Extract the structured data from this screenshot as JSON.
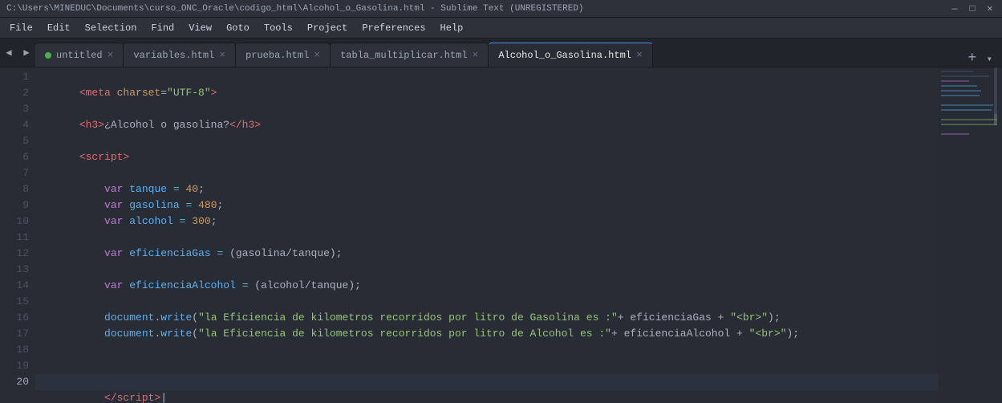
{
  "titlebar": {
    "path": "C:\\Users\\MINEDUC\\Documents\\curso_ONC_Oracle\\codigo_html\\Alcohol_o_Gasolina.html - Sublime Text (UNREGISTERED)",
    "controls": [
      "—",
      "□",
      "✕"
    ]
  },
  "menubar": {
    "items": [
      "File",
      "Edit",
      "Selection",
      "Find",
      "View",
      "Goto",
      "Tools",
      "Project",
      "Preferences",
      "Help"
    ]
  },
  "tabs": [
    {
      "id": "untitled",
      "label": "untitled",
      "active": false,
      "dot": true,
      "close": true
    },
    {
      "id": "variables",
      "label": "variables.html",
      "active": false,
      "dot": false,
      "close": true
    },
    {
      "id": "prueba",
      "label": "prueba.html",
      "active": false,
      "dot": false,
      "close": true
    },
    {
      "id": "tabla_multiplicar",
      "label": "tabla_multiplicar.html",
      "active": false,
      "dot": false,
      "close": true
    },
    {
      "id": "alcohol",
      "label": "Alcohol_o_Gasolina.html",
      "active": true,
      "dot": false,
      "close": true
    }
  ],
  "lines": [
    {
      "num": 1,
      "content": "meta_charset_line",
      "current": false
    },
    {
      "num": 2,
      "content": "empty",
      "current": false
    },
    {
      "num": 3,
      "content": "h3_line",
      "current": false
    },
    {
      "num": 4,
      "content": "empty",
      "current": false
    },
    {
      "num": 5,
      "content": "script_open",
      "current": false
    },
    {
      "num": 6,
      "content": "empty",
      "current": false
    },
    {
      "num": 7,
      "content": "var_tanque",
      "current": false
    },
    {
      "num": 8,
      "content": "var_gasolina",
      "current": false
    },
    {
      "num": 9,
      "content": "var_alcohol",
      "current": false
    },
    {
      "num": 10,
      "content": "empty",
      "current": false
    },
    {
      "num": 11,
      "content": "var_eficienciaGas",
      "current": false
    },
    {
      "num": 12,
      "content": "empty",
      "current": false
    },
    {
      "num": 13,
      "content": "var_eficienciaAlcohol",
      "current": false
    },
    {
      "num": 14,
      "content": "empty",
      "current": false
    },
    {
      "num": 15,
      "content": "doc_write_gas",
      "current": false
    },
    {
      "num": 16,
      "content": "doc_write_alcohol",
      "current": false
    },
    {
      "num": 17,
      "content": "empty",
      "current": false
    },
    {
      "num": 18,
      "content": "empty",
      "current": false
    },
    {
      "num": 19,
      "content": "empty",
      "current": false
    },
    {
      "num": 20,
      "content": "script_close",
      "current": true
    }
  ],
  "colors": {
    "bg": "#282c34",
    "activeLine": "#2c323d",
    "accent": "#528bff"
  }
}
